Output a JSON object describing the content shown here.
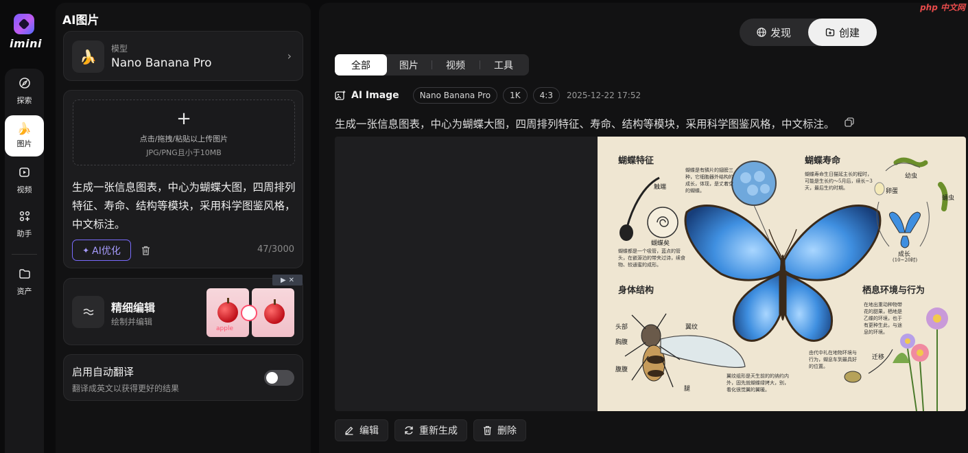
{
  "brand": {
    "name": "imini"
  },
  "rail": {
    "items": [
      {
        "label": "探索",
        "icon": "explore-icon"
      },
      {
        "label": "图片",
        "icon": "banana-icon"
      },
      {
        "label": "视频",
        "icon": "video-icon"
      },
      {
        "label": "助手",
        "icon": "assistant-icon"
      },
      {
        "label": "资产",
        "icon": "folder-icon"
      }
    ]
  },
  "panel": {
    "title": "AI图片",
    "model": {
      "label": "模型",
      "name": "Nano Banana Pro"
    },
    "upload": {
      "line1": "点击/拖拽/粘贴以上传图片",
      "line2": "JPG/PNG且小于10MB"
    },
    "prompt": "生成一张信息图表，中心为蝴蝶大图，四周排列特征、寿命、结构等模块，采用科学图鉴风格，中文标注。",
    "ai_optimize": "AI优化",
    "counter": "47/3000",
    "fine_edit": {
      "title": "精细编辑",
      "subtitle": "绘制并编辑",
      "thumb_text": "apple"
    },
    "translate": {
      "title": "启用自动翻译",
      "subtitle": "翻译成英文以获得更好的结果",
      "enabled": false
    }
  },
  "main": {
    "switch": {
      "discover": "发现",
      "create": "创建"
    },
    "watermark": "php 中文网",
    "tabs": [
      "全部",
      "图片",
      "视频",
      "工具"
    ],
    "meta": {
      "type": "AI Image",
      "model": "Nano Banana Pro",
      "resolution": "1K",
      "ratio": "4:3",
      "date": "2025-12-22 17:52"
    },
    "prompt": "生成一张信息图表，中心为蝴蝶大图，四周排列特征、寿命、结构等模块，采用科学图鉴风格，中文标注。",
    "infographic": {
      "features_title": "蝴蝶特征",
      "lifespan_title": "蝴蝶寿命",
      "structure_title": "身体结构",
      "habitat_title": "栖息环境与行为",
      "antenna": "触端",
      "proboscis": "蝴蝶矣",
      "scale_note": "蝴蝶是有鳞片的翅膀三种，它细胞器外结构的成长，体现，是丈着空的蝴蝶。",
      "proboscis_note": "蝴蝶都是一个吸管，蓝点的管头，在嵌源泊的带夹过诗，续食物、较通蜜的成形。",
      "life_note": "蝴蝶寿命生日猫延主长的程时，可能是生长约～5月后，续长~3天，最后生约时期。",
      "stage_larva": "幼虫",
      "stage_egg": "卵蛋",
      "stage_pupa": "蛹虫",
      "stage_adult": "成长",
      "stage_adult_sub": "(10~20时)",
      "head": "头部",
      "thorax": "胸腹",
      "abdomen": "腹腹",
      "wing": "翼纹",
      "leg": "腿",
      "wing_note": "翼纹组形是天生前的的纳约内外，固先就蝴蝶绿拷大，别，看化很觉翼的翼暖。",
      "habitat_note": "在地出重动种物带花的甜果，栖地是乙蝶的环境，也于有更种生此，与途息的环境。",
      "migrate": "迁移",
      "migrate_note": "由代中礼在地物环境与行为，蝴息车到最具好的位置。"
    },
    "actions": [
      {
        "label": "编辑",
        "icon": "pencil-icon"
      },
      {
        "label": "重新生成",
        "icon": "refresh-icon"
      },
      {
        "label": "删除",
        "icon": "trash-icon"
      }
    ]
  },
  "colors": {
    "accent": "#7a6cff",
    "butterfly_blue": "#3f8fe0"
  }
}
